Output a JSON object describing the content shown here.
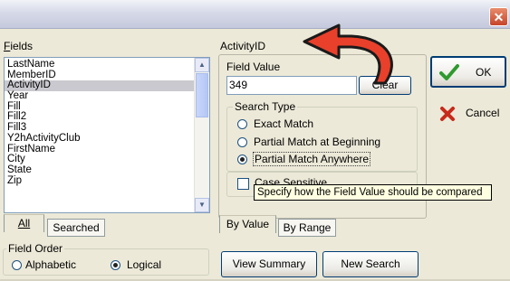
{
  "window": {
    "close_glyph": "✕"
  },
  "fields_panel": {
    "label": "Fields",
    "items": [
      "LastName",
      "MemberID",
      "ActivityID",
      "Year",
      "Fill",
      "Fill2",
      "Fill3",
      "Y2hActivityClub",
      "FirstName",
      "City",
      "State",
      "Zip"
    ],
    "selected": "ActivityID",
    "scroll_up_glyph": "▲",
    "scroll_down_glyph": "▼",
    "tabs": [
      "All",
      "Searched"
    ],
    "active_tab": "All"
  },
  "field_order": {
    "title": "Field Order",
    "options": [
      "Alphabetic",
      "Logical"
    ],
    "selected": "Logical"
  },
  "criteria": {
    "field_name": "ActivityID",
    "field_value_label": "Field Value",
    "field_value": "349",
    "clear_label": "Clear",
    "search_type_title": "Search Type",
    "search_types": [
      "Exact Match",
      "Partial Match at Beginning",
      "Partial Match Anywhere"
    ],
    "selected_search_type": "Partial Match Anywhere",
    "case_sensitive_label": "Case Sensitive",
    "case_sensitive_checked": false,
    "tabs": [
      "By Value",
      "By Range"
    ],
    "active_tab": "By Value"
  },
  "tooltip": "Specify how the Field Value should be compared",
  "buttons": {
    "ok": "OK",
    "cancel": "Cancel",
    "view_summary": "View Summary",
    "new_search": "New Search"
  },
  "icons": {
    "ok": "green-checkmark-icon",
    "cancel": "red-x-icon",
    "annotation": "curved-arrow-icon"
  },
  "colors": {
    "accent_arrow": "#e8402a",
    "ok_check": "#2f9a2f",
    "cancel_x": "#c72a1a",
    "selection": "#c9c9cf",
    "tooltip_bg": "#ffffe1"
  }
}
